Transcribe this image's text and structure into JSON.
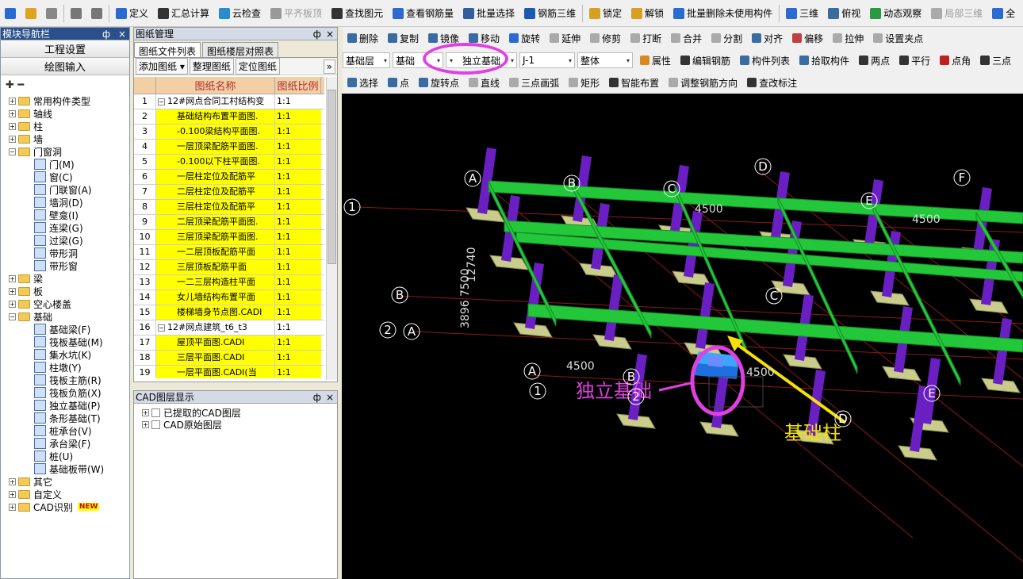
{
  "toolbar1": {
    "items": [
      {
        "label": "",
        "icon": "new-file-icon"
      },
      {
        "label": "",
        "icon": "open-folder-icon"
      },
      {
        "label": "",
        "icon": "save-icon",
        "disabled": true
      },
      {
        "label": "",
        "icon": "undo-icon",
        "disabled": true
      },
      {
        "label": "",
        "icon": "redo-icon",
        "disabled": true
      },
      {
        "label": "定义",
        "icon": "define-icon"
      },
      {
        "label": "汇总计算",
        "icon": "sigma-icon"
      },
      {
        "label": "云检查",
        "icon": "cloud-check-icon"
      },
      {
        "label": "平齐板顶",
        "icon": "flush-slab-icon",
        "disabled": true
      },
      {
        "label": "查找图元",
        "icon": "binoculars-icon"
      },
      {
        "label": "查看钢筋量",
        "icon": "rebar-qty-icon"
      },
      {
        "label": "批量选择",
        "icon": "batch-select-icon"
      },
      {
        "label": "钢筋三维",
        "icon": "rebar-3d-icon"
      },
      {
        "label": "锁定",
        "icon": "lock-icon"
      },
      {
        "label": "解锁",
        "icon": "unlock-icon"
      },
      {
        "label": "批量删除未使用构件",
        "icon": "batch-delete-icon"
      },
      {
        "label": "三维",
        "icon": "cube-icon"
      },
      {
        "label": "俯视",
        "icon": "top-view-icon"
      },
      {
        "label": "动态观察",
        "icon": "orbit-icon"
      },
      {
        "label": "局部三维",
        "icon": "local-3d-icon",
        "disabled": true
      },
      {
        "label": "全",
        "icon": "zoom-icon"
      }
    ]
  },
  "nav": {
    "title": "模块导航栏",
    "pin": "ф",
    "close": "×",
    "btn1": "工程设置",
    "btn2": "绘图输入",
    "tree_tools": "✚ ━",
    "tree": [
      {
        "label": "常用构件类型",
        "pm": "+",
        "level": 0
      },
      {
        "label": "轴线",
        "pm": "+",
        "level": 0
      },
      {
        "label": "柱",
        "pm": "+",
        "level": 0
      },
      {
        "label": "墙",
        "pm": "+",
        "level": 0
      },
      {
        "label": "门窗洞",
        "pm": "−",
        "level": 0,
        "open": true
      },
      {
        "label": "门(M)",
        "level": 1
      },
      {
        "label": "窗(C)",
        "level": 1
      },
      {
        "label": "门联窗(A)",
        "level": 1
      },
      {
        "label": "墙洞(D)",
        "level": 1
      },
      {
        "label": "壁龛(I)",
        "level": 1
      },
      {
        "label": "连梁(G)",
        "level": 1
      },
      {
        "label": "过梁(G)",
        "level": 1
      },
      {
        "label": "带形洞",
        "level": 1
      },
      {
        "label": "带形窗",
        "level": 1
      },
      {
        "label": "梁",
        "pm": "+",
        "level": 0
      },
      {
        "label": "板",
        "pm": "+",
        "level": 0
      },
      {
        "label": "空心楼盖",
        "pm": "+",
        "level": 0
      },
      {
        "label": "基础",
        "pm": "−",
        "level": 0,
        "open": true
      },
      {
        "label": "基础梁(F)",
        "level": 1
      },
      {
        "label": "筏板基础(M)",
        "level": 1
      },
      {
        "label": "集水坑(K)",
        "level": 1
      },
      {
        "label": "柱墩(Y)",
        "level": 1
      },
      {
        "label": "筏板主筋(R)",
        "level": 1
      },
      {
        "label": "筏板负筋(X)",
        "level": 1
      },
      {
        "label": "独立基础(P)",
        "level": 1
      },
      {
        "label": "条形基础(T)",
        "level": 1
      },
      {
        "label": "桩承台(V)",
        "level": 1
      },
      {
        "label": "承台梁(F)",
        "level": 1
      },
      {
        "label": "桩(U)",
        "level": 1
      },
      {
        "label": "基础板带(W)",
        "level": 1
      },
      {
        "label": "其它",
        "pm": "+",
        "level": 0
      },
      {
        "label": "自定义",
        "pm": "+",
        "level": 0
      },
      {
        "label": "CAD识别",
        "pm": "+",
        "level": 0,
        "badge": "NEW"
      }
    ]
  },
  "drawing": {
    "title": "图纸管理",
    "tab1": "图纸文件列表",
    "tab2": "图纸楼层对照表",
    "btn_add": "添加图纸",
    "btn_org": "整理图纸",
    "btn_loc": "定位图纸",
    "more": "»",
    "col_name": "图纸名称",
    "col_ratio": "图纸比例",
    "rows": [
      {
        "n": "1",
        "name": "12#网点合同工村结构变",
        "ratio": "1:1",
        "hl": false,
        "group": true
      },
      {
        "n": "2",
        "name": "基础结构布置平面图.",
        "ratio": "1:1",
        "hl": true
      },
      {
        "n": "3",
        "name": "-0.100梁结构平面图.",
        "ratio": "1:1",
        "hl": true
      },
      {
        "n": "4",
        "name": "一层顶梁配筋平面图.",
        "ratio": "1:1",
        "hl": true
      },
      {
        "n": "5",
        "name": "-0.100以下柱平面图.",
        "ratio": "1:1",
        "hl": true
      },
      {
        "n": "6",
        "name": "一层柱定位及配筋平",
        "ratio": "1:1",
        "hl": true
      },
      {
        "n": "7",
        "name": "二层柱定位及配筋平",
        "ratio": "1:1",
        "hl": true
      },
      {
        "n": "8",
        "name": "三层柱定位及配筋平",
        "ratio": "1:1",
        "hl": true
      },
      {
        "n": "9",
        "name": "二层顶梁配筋平面图.",
        "ratio": "1:1",
        "hl": true
      },
      {
        "n": "10",
        "name": "三层顶梁配筋平面图.",
        "ratio": "1:1",
        "hl": true
      },
      {
        "n": "11",
        "name": "一二层顶板配筋平面",
        "ratio": "1:1",
        "hl": true
      },
      {
        "n": "12",
        "name": "三层顶板配筋平面",
        "ratio": "1:1",
        "hl": true
      },
      {
        "n": "13",
        "name": "一二三层构造柱平面",
        "ratio": "1:1",
        "hl": true
      },
      {
        "n": "14",
        "name": "女儿墙结构布置平面",
        "ratio": "1:1",
        "hl": true
      },
      {
        "n": "15",
        "name": "楼梯墙身节点图.CADI",
        "ratio": "1:1",
        "hl": true
      },
      {
        "n": "16",
        "name": "12#网点建筑_t6_t3",
        "ratio": "1:1",
        "hl": false,
        "group": true
      },
      {
        "n": "17",
        "name": "屋顶平面图.CADI",
        "ratio": "1:1",
        "hl": true
      },
      {
        "n": "18",
        "name": "三层平面图.CADI",
        "ratio": "1:1",
        "hl": true
      },
      {
        "n": "19",
        "name": "一层平面图.CADI(当",
        "ratio": "1:1",
        "hl": true
      }
    ]
  },
  "cad": {
    "title": "CAD图层显示",
    "layers": [
      "已提取的CAD图层",
      "CAD原始图层"
    ]
  },
  "row2": {
    "items": [
      "删除",
      "复制",
      "镜像",
      "移动",
      "旋转",
      "延伸",
      "修剪",
      "打断",
      "合并",
      "分割",
      "对齐",
      "偏移",
      "拉伸",
      "设置夹点"
    ]
  },
  "row3": {
    "floor": "基础层",
    "category": "基础",
    "type": "独立基础",
    "component": "J-1",
    "scope": "整体",
    "items": [
      "属性",
      "编辑钢筋",
      "构件列表",
      "拾取构件",
      "两点",
      "平行",
      "点角",
      "三点"
    ]
  },
  "row4": {
    "items": [
      "选择",
      "点",
      "旋转点",
      "直线",
      "三点画弧",
      "矩形",
      "智能布置",
      "调整钢筋方向",
      "查改标注"
    ]
  },
  "canvas": {
    "axes": [
      "A",
      "B",
      "C",
      "D",
      "E",
      "F",
      "1",
      "B",
      "2",
      "A",
      "A",
      "B",
      "1",
      "2",
      "C",
      "D",
      "E"
    ],
    "dims": [
      "4500",
      "4500",
      "4500",
      "4500",
      "12740",
      "7500",
      "3896"
    ],
    "annot1": "独立基础",
    "annot2": "基础柱"
  },
  "colors": {
    "beam": "#22c83a",
    "column": "#6a1fc2",
    "footing": "#c9cc8a",
    "highlight": "#1e90ff",
    "annot1": "#e040e0",
    "annot2": "#f5e00a",
    "axis": "#ffffff",
    "gridline": "#c02020"
  }
}
